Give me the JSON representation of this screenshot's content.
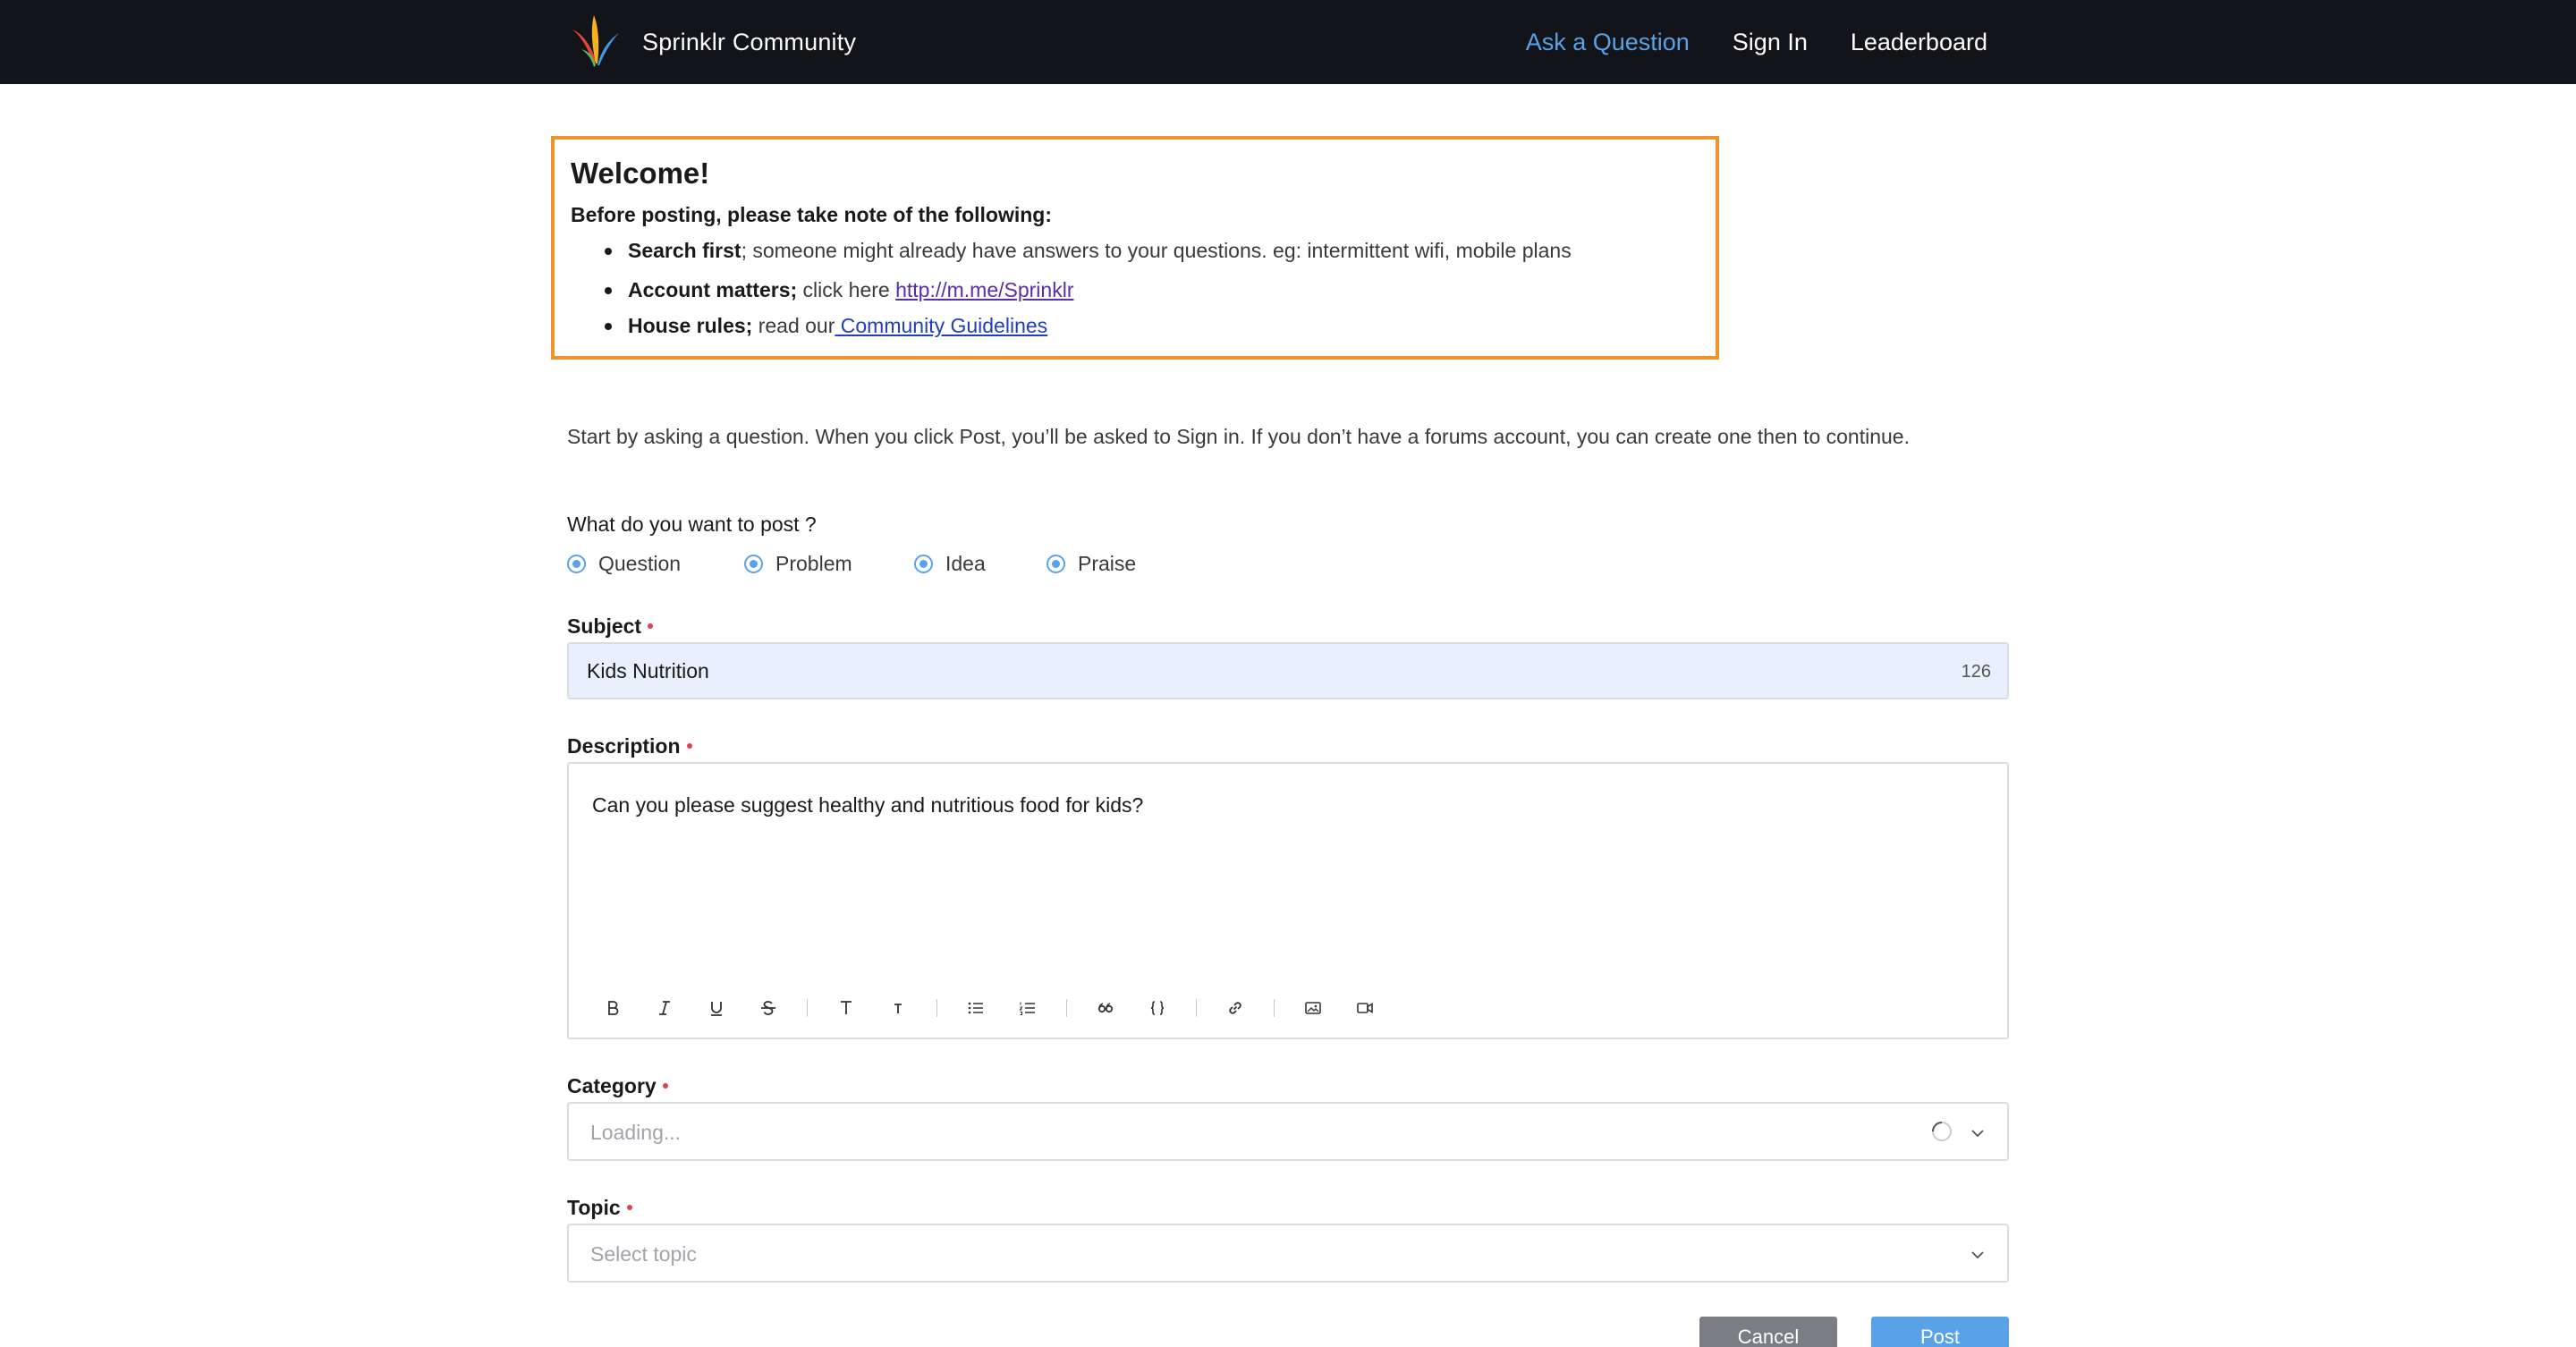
{
  "header": {
    "brand": "Sprinklr Community",
    "nav": [
      "Ask a Question",
      "Sign In",
      "Leaderboard"
    ]
  },
  "welcome": {
    "title": "Welcome!",
    "note": "Before posting, please take note of the following:",
    "items": [
      {
        "bold": "Search first",
        "text": "; someone might already have answers to your questions. eg: intermittent wifi, mobile plans"
      },
      {
        "bold": "Account matters;",
        "text": " click here ",
        "link": "http://m.me/Sprinklr"
      },
      {
        "bold": "House rules;",
        "text": " read our",
        "link": " Community Guidelines"
      }
    ]
  },
  "intro": "Start by asking a question. When you click Post, you’ll be asked to Sign in. If you don’t have a forums account, you can create one then to continue.",
  "post_type": {
    "label": "What do you want to post ?",
    "options": [
      "Question",
      "Problem",
      "Idea",
      "Praise"
    ]
  },
  "subject": {
    "label": "Subject",
    "value": "Kids Nutrition",
    "counter": "126"
  },
  "description": {
    "label": "Description",
    "value": "Can you please suggest healthy and nutritious food for kids?"
  },
  "category": {
    "label": "Category",
    "placeholder": "Loading..."
  },
  "topic": {
    "label": "Topic",
    "placeholder": "Select topic"
  },
  "buttons": {
    "cancel": "Cancel",
    "post": "Post"
  },
  "colors": {
    "header_bg": "#121419",
    "accent": "#5aa2e8",
    "welcome_border": "#f0932b",
    "required": "#e0424b"
  }
}
